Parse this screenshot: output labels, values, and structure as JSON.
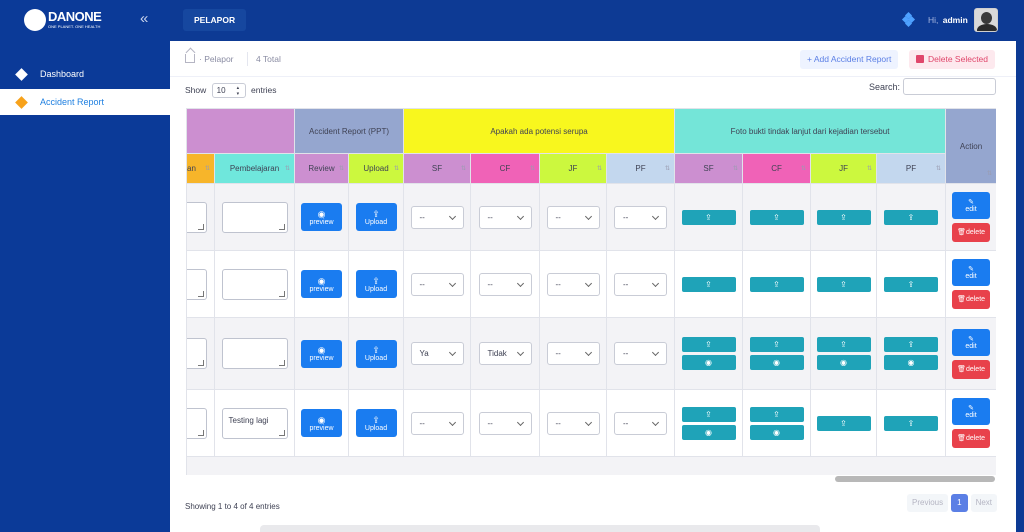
{
  "brand": {
    "name": "DANONE",
    "tagline": "ONE PLANET. ONE HEALTH"
  },
  "sidebar": {
    "items": [
      {
        "label": "Dashboard",
        "active": false
      },
      {
        "label": "Accident Report",
        "active": true
      }
    ]
  },
  "topbar": {
    "title": "PELAPOR",
    "greeting": "Hi,",
    "username": "admin"
  },
  "subheader": {
    "breadcrumb": "Pelapor",
    "total": "4 Total",
    "add_label": "Add Accident Report",
    "delete_label": "Delete Selected"
  },
  "controls": {
    "show_label": "Show",
    "entries_value": "10",
    "entries_label": "entries",
    "search_label": "Search:"
  },
  "colors": {
    "purple": "#cc8fd0",
    "grey_blue": "#95a6cf",
    "yellow": "#f8f71e",
    "teal": "#74e5d8",
    "orange": "#f7b52a",
    "cyan": "#6fe7dc",
    "pink": "#f062b7",
    "lime": "#ccf83e",
    "light_blue": "#c3d7ee",
    "button_blue": "#1a7cf0",
    "button_teal": "#1fa3b8",
    "button_red": "#e8414b"
  },
  "table": {
    "group_headers": [
      {
        "label": ""
      },
      {
        "label": "Accident Report (PPT)"
      },
      {
        "label": "Apakah ada potensi serupa"
      },
      {
        "label": "Foto bukti tindak lanjut dari kejadian tersebut"
      },
      {
        "label": "Action"
      }
    ],
    "columns": [
      "an",
      "Pembelajaran",
      "Review",
      "Upload",
      "SF",
      "CF",
      "JF",
      "PF",
      "SF",
      "CF",
      "JF",
      "PF"
    ],
    "rows": [
      {
        "pembelajaran": "",
        "review": "preview",
        "upload": "Upload",
        "potensi": [
          "--",
          "--",
          "--",
          "--"
        ],
        "photos": [
          1,
          1,
          1,
          1
        ],
        "edit": "edit",
        "delete": "delete"
      },
      {
        "pembelajaran": "",
        "review": "preview",
        "upload": "Upload",
        "potensi": [
          "--",
          "--",
          "--",
          "--"
        ],
        "photos": [
          1,
          1,
          1,
          1
        ],
        "edit": "edit",
        "delete": "delete"
      },
      {
        "pembelajaran": "",
        "review": "preview",
        "upload": "Upload",
        "potensi": [
          "Ya",
          "Tidak",
          "--",
          "--"
        ],
        "photos": [
          2,
          2,
          2,
          2
        ],
        "edit": "edit",
        "delete": "delete"
      },
      {
        "pembelajaran": "Testing lagi",
        "review": "preview",
        "upload": "Upload",
        "potensi": [
          "--",
          "--",
          "--",
          "--"
        ],
        "photos": [
          2,
          2,
          1,
          1
        ],
        "edit": "edit",
        "delete": "delete"
      }
    ]
  },
  "footer": {
    "info": "Showing 1 to 4 of 4 entries",
    "previous": "Previous",
    "page": "1",
    "next": "Next"
  }
}
